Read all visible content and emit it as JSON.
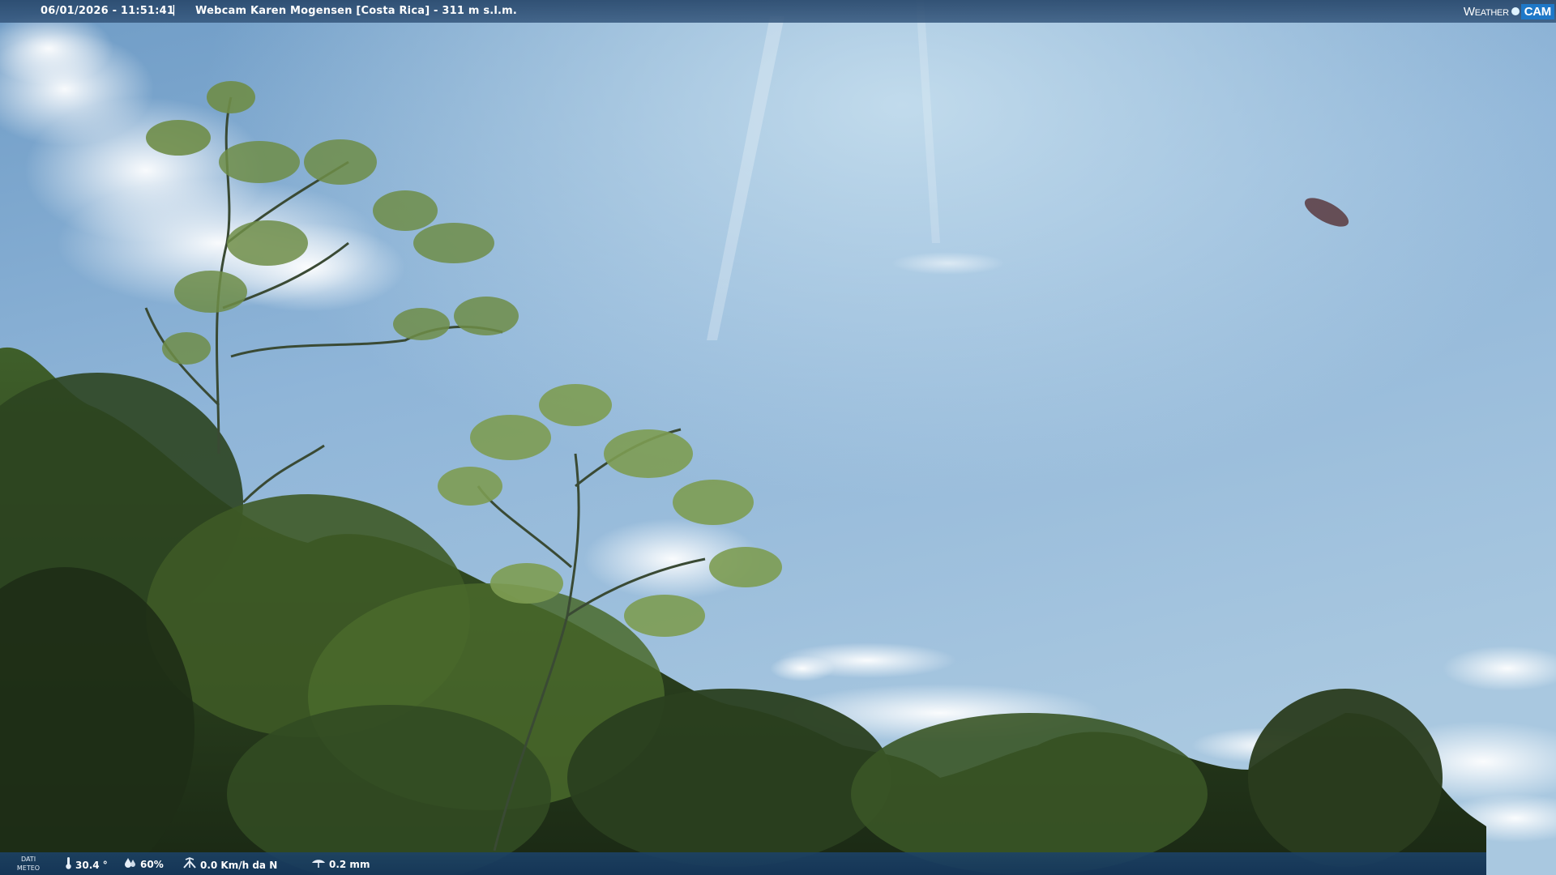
{
  "overlay_top": {
    "timestamp": "06/01/2026 - 11:51:41",
    "separator": "|",
    "title": "Webcam Karen Mogensen [Costa Rica] - 311 m s.l.m.",
    "logo_word": "Weather",
    "logo_cam": "CAM"
  },
  "overlay_bottom": {
    "dati_line1": "DATI",
    "dati_line2": "METEO",
    "temperature": "30.4 °",
    "humidity": "60%",
    "wind": "0.0 Km/h da N",
    "rain": "0.2 mm",
    "icons": {
      "temperature": "thermometer-icon",
      "humidity": "humidity-drop-icon",
      "wind": "wind-icon",
      "rain": "rain-gauge-icon"
    }
  },
  "scene": {
    "description_colors": {
      "sky_top": "#7aa6cc",
      "sky_bottom": "#9cc0dc",
      "foliage_dark": "#243a1c",
      "foliage_light": "#8fae5a"
    }
  }
}
